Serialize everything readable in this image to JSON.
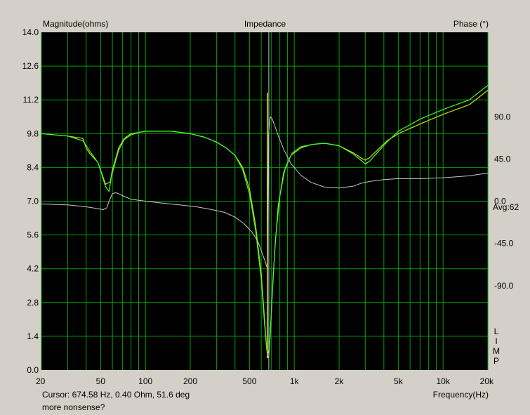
{
  "header": {
    "title": "Impedance",
    "left_axis_label": "Magnitude(ohms)",
    "right_axis_label": "Phase (°)"
  },
  "footer": {
    "cursor_readout": "Cursor: 674.58 Hz, 0.40 Ohm, 51.6 deg",
    "note": "more nonsense?",
    "x_axis_label": "Frequency(Hz)"
  },
  "side_panel": {
    "avg_label": "Avg:62",
    "limp_letters": [
      "L",
      "I",
      "M",
      "P"
    ]
  },
  "colors": {
    "plot_background": "#000000",
    "grid": "#00a000",
    "magnitude_trace_1": "#c8e600",
    "magnitude_trace_2": "#33ff33",
    "phase_trace": "#c8c8c8",
    "cursor_line": "#c8c8c8",
    "marker_line": "#e0e040",
    "window_background": "#d4d0c8"
  },
  "chart_data": {
    "type": "line",
    "title": "Impedance",
    "xlabel": "Frequency(Hz)",
    "ylabel": "Magnitude(ohms)",
    "y2label": "Phase (°)",
    "xscale": "log",
    "xlim": [
      20,
      20000
    ],
    "ylim": [
      0,
      14
    ],
    "y2lim": [
      -180,
      180
    ],
    "grid": true,
    "x_ticks": [
      20,
      50,
      100,
      200,
      500,
      1000,
      2000,
      5000,
      10000,
      20000
    ],
    "x_tick_labels": [
      "20",
      "50",
      "100",
      "200",
      "500",
      "1k",
      "2k",
      "5k",
      "10k",
      "20k"
    ],
    "y_ticks": [
      0,
      1.4,
      2.8,
      4.2,
      5.6,
      7.0,
      8.4,
      9.8,
      11.2,
      12.6,
      14.0
    ],
    "y_tick_labels": [
      "0.0",
      "1.4",
      "2.8",
      "4.2",
      "5.6",
      "7.0",
      "8.4",
      "9.8",
      "11.2",
      "12.6",
      "14.0"
    ],
    "y2_ticks": [
      90,
      45,
      0,
      -45,
      -90
    ],
    "y2_tick_labels": [
      "90.0",
      "45.0",
      "0.0",
      "-45.0",
      "-90.0"
    ],
    "cursor_x": 674.58,
    "marker_x": 660,
    "series": [
      {
        "axis": "left",
        "color": "#c8e600",
        "x": [
          20,
          30,
          38,
          40,
          42,
          48,
          54,
          58,
          60,
          62,
          66,
          72,
          80,
          90,
          100,
          120,
          150,
          200,
          250,
          300,
          350,
          400,
          450,
          500,
          550,
          600,
          630,
          650,
          665,
          675,
          690,
          710,
          740,
          780,
          850,
          950,
          1100,
          1300,
          1600,
          2000,
          2500,
          2800,
          3000,
          3200,
          3600,
          4200,
          5000,
          7000,
          10000,
          15000,
          20000
        ],
        "y": [
          9.8,
          9.7,
          9.6,
          9.2,
          9.0,
          8.6,
          7.7,
          7.8,
          8.3,
          8.6,
          9.2,
          9.6,
          9.8,
          9.85,
          9.9,
          9.9,
          9.9,
          9.8,
          9.65,
          9.45,
          9.2,
          8.9,
          8.4,
          7.5,
          6.0,
          4.0,
          2.2,
          1.0,
          0.5,
          0.6,
          1.5,
          3.0,
          5.0,
          6.8,
          8.2,
          8.9,
          9.2,
          9.35,
          9.4,
          9.3,
          9.0,
          8.8,
          8.7,
          8.8,
          9.1,
          9.5,
          9.8,
          10.2,
          10.6,
          11.0,
          11.6
        ]
      },
      {
        "axis": "left",
        "color": "#33ff33",
        "x": [
          20,
          30,
          38,
          40,
          42,
          48,
          54,
          57,
          59,
          62,
          66,
          72,
          80,
          90,
          100,
          120,
          150,
          200,
          250,
          300,
          350,
          400,
          450,
          500,
          550,
          600,
          630,
          655,
          670,
          685,
          700,
          720,
          750,
          800,
          870,
          970,
          1100,
          1300,
          1600,
          2000,
          2500,
          2800,
          3000,
          3200,
          3600,
          4200,
          5000,
          7000,
          10000,
          15000,
          20000
        ],
        "y": [
          9.8,
          9.7,
          9.5,
          9.3,
          9.1,
          8.6,
          7.6,
          7.4,
          8.0,
          8.5,
          9.1,
          9.55,
          9.75,
          9.85,
          9.9,
          9.9,
          9.9,
          9.8,
          9.65,
          9.45,
          9.2,
          8.9,
          8.3,
          7.3,
          5.8,
          3.8,
          2.0,
          0.8,
          0.7,
          1.2,
          2.2,
          3.8,
          5.5,
          7.2,
          8.4,
          9.0,
          9.25,
          9.35,
          9.4,
          9.3,
          8.95,
          8.7,
          8.55,
          8.65,
          9.0,
          9.45,
          9.9,
          10.4,
          10.8,
          11.2,
          11.8
        ]
      },
      {
        "axis": "right",
        "color": "#c8c8c8",
        "x": [
          20,
          30,
          40,
          48,
          52,
          55,
          57,
          60,
          63,
          66,
          70,
          80,
          100,
          130,
          170,
          220,
          280,
          340,
          400,
          460,
          520,
          570,
          610,
          640,
          660,
          672,
          690,
          710,
          740,
          780,
          850,
          950,
          1100,
          1300,
          1600,
          2000,
          2500,
          2800,
          3200,
          4000,
          5000,
          7000,
          10000,
          15000,
          20000
        ],
        "y": [
          -3,
          -4,
          -6,
          -8,
          -9,
          -7,
          0,
          8,
          9,
          8,
          6,
          2,
          0,
          -2,
          -4,
          -6,
          -9,
          -12,
          -17,
          -24,
          -33,
          -43,
          -56,
          -65,
          -72,
          72,
          90,
          88,
          80,
          70,
          55,
          40,
          28,
          20,
          15,
          14,
          16,
          19,
          21,
          23,
          24,
          24,
          25,
          27,
          30
        ]
      }
    ]
  }
}
